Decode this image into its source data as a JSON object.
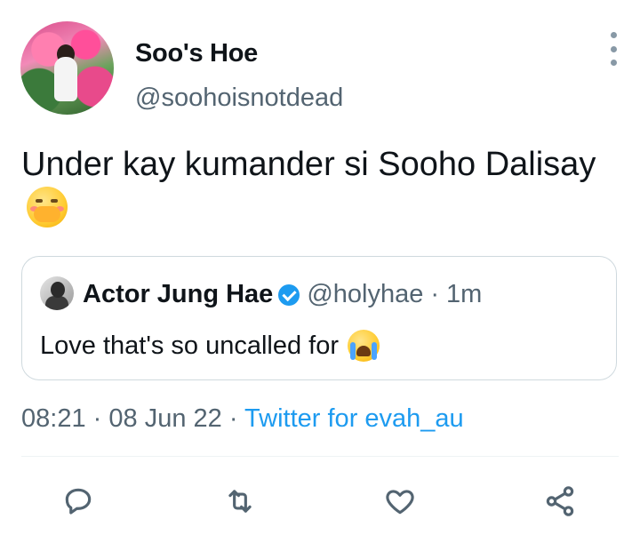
{
  "author": {
    "display_name": "Soo's Hoe",
    "handle": "@soohoisnotdead"
  },
  "tweet": {
    "text": "Under kay kumander si Sooho Dalisay",
    "emoji": "hand-over-mouth-emoji"
  },
  "quoted_tweet": {
    "display_name": "Actor Jung Hae",
    "verified": true,
    "handle": "@holyhae",
    "separator": "·",
    "time_ago": "1m",
    "text": "Love that's so uncalled for",
    "emoji": "loudly-crying-face-emoji"
  },
  "meta": {
    "time": "08:21",
    "sep1": "·",
    "date": "08 Jun 22",
    "sep2": "·",
    "client": "Twitter for evah_au"
  },
  "actions": [
    "reply-icon",
    "retweet-icon",
    "like-icon",
    "share-icon"
  ],
  "colors": {
    "text": "#0f1419",
    "muted": "#536471",
    "accent": "#1d9bf0",
    "border": "#cfd9de",
    "icon": "#536471"
  }
}
